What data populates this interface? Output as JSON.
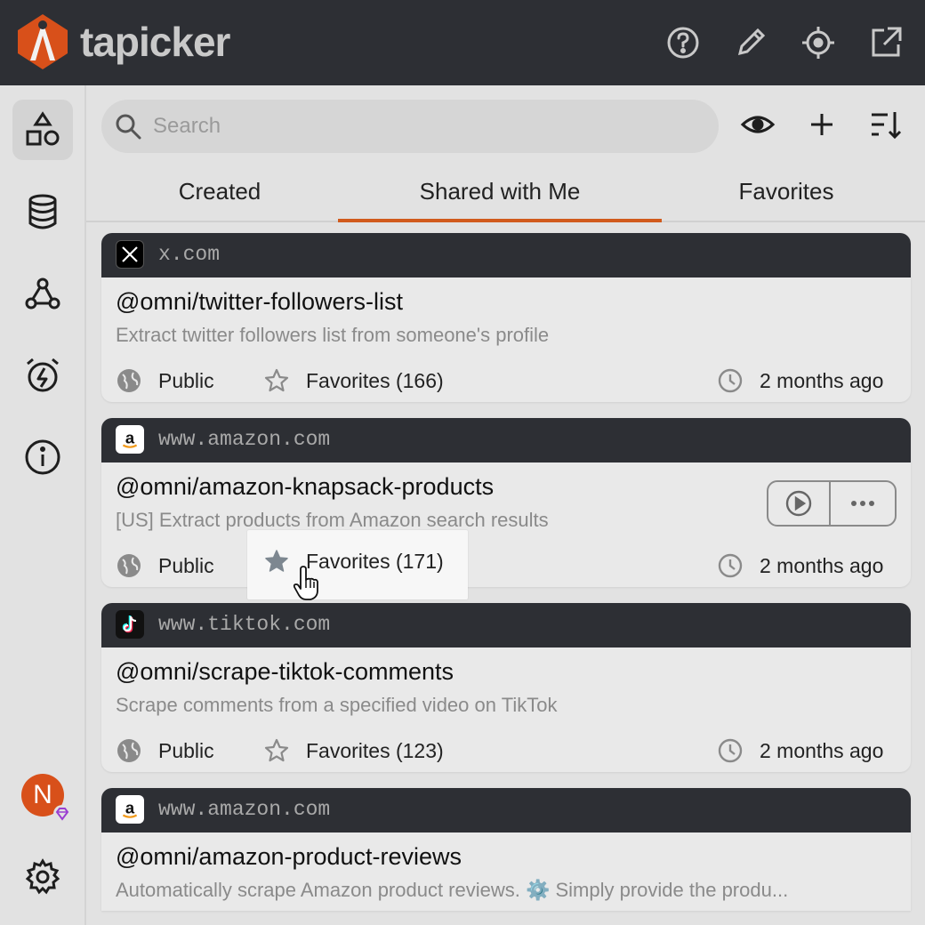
{
  "app": {
    "brand": "tapicker",
    "colors": {
      "accent": "#d15a1c",
      "topbar": "#2d2f34",
      "background": "#e2e2e2"
    }
  },
  "topbar": {
    "icons": [
      "help-icon",
      "edit-pencil-icon",
      "target-crosshair-icon",
      "open-external-icon"
    ]
  },
  "sidebar": {
    "items": [
      "shapes-icon",
      "database-icon",
      "webhook-icon",
      "alarm-clock-icon",
      "info-icon"
    ],
    "avatar_initial": "N"
  },
  "search": {
    "placeholder": "Search",
    "value": ""
  },
  "toolbar": {
    "icons": [
      "eye-icon",
      "plus-icon",
      "sort-icon"
    ]
  },
  "tabs": [
    {
      "label": "Created",
      "active": false
    },
    {
      "label": "Shared with Me",
      "active": true
    },
    {
      "label": "Favorites",
      "active": false
    }
  ],
  "cards": [
    {
      "domain": "x.com",
      "title": "@omni/twitter-followers-list",
      "description": "Extract twitter followers list from someone's profile",
      "visibility": "Public",
      "favorites": "Favorites (166)",
      "time": "2 months ago"
    },
    {
      "domain": "www.amazon.com",
      "title": "@omni/amazon-knapsack-products",
      "description": "[US] Extract products from Amazon search results",
      "visibility": "Public",
      "favorites": "Favorites (171)",
      "time": "2 months ago"
    },
    {
      "domain": "www.tiktok.com",
      "title": "@omni/scrape-tiktok-comments",
      "description": "Scrape comments from a specified video on TikTok",
      "visibility": "Public",
      "favorites": "Favorites (123)",
      "time": "2 months ago"
    },
    {
      "domain": "www.amazon.com",
      "title": "@omni/amazon-product-reviews",
      "description": "Automatically scrape Amazon product reviews. ⚙️ Simply provide the produ..."
    }
  ]
}
